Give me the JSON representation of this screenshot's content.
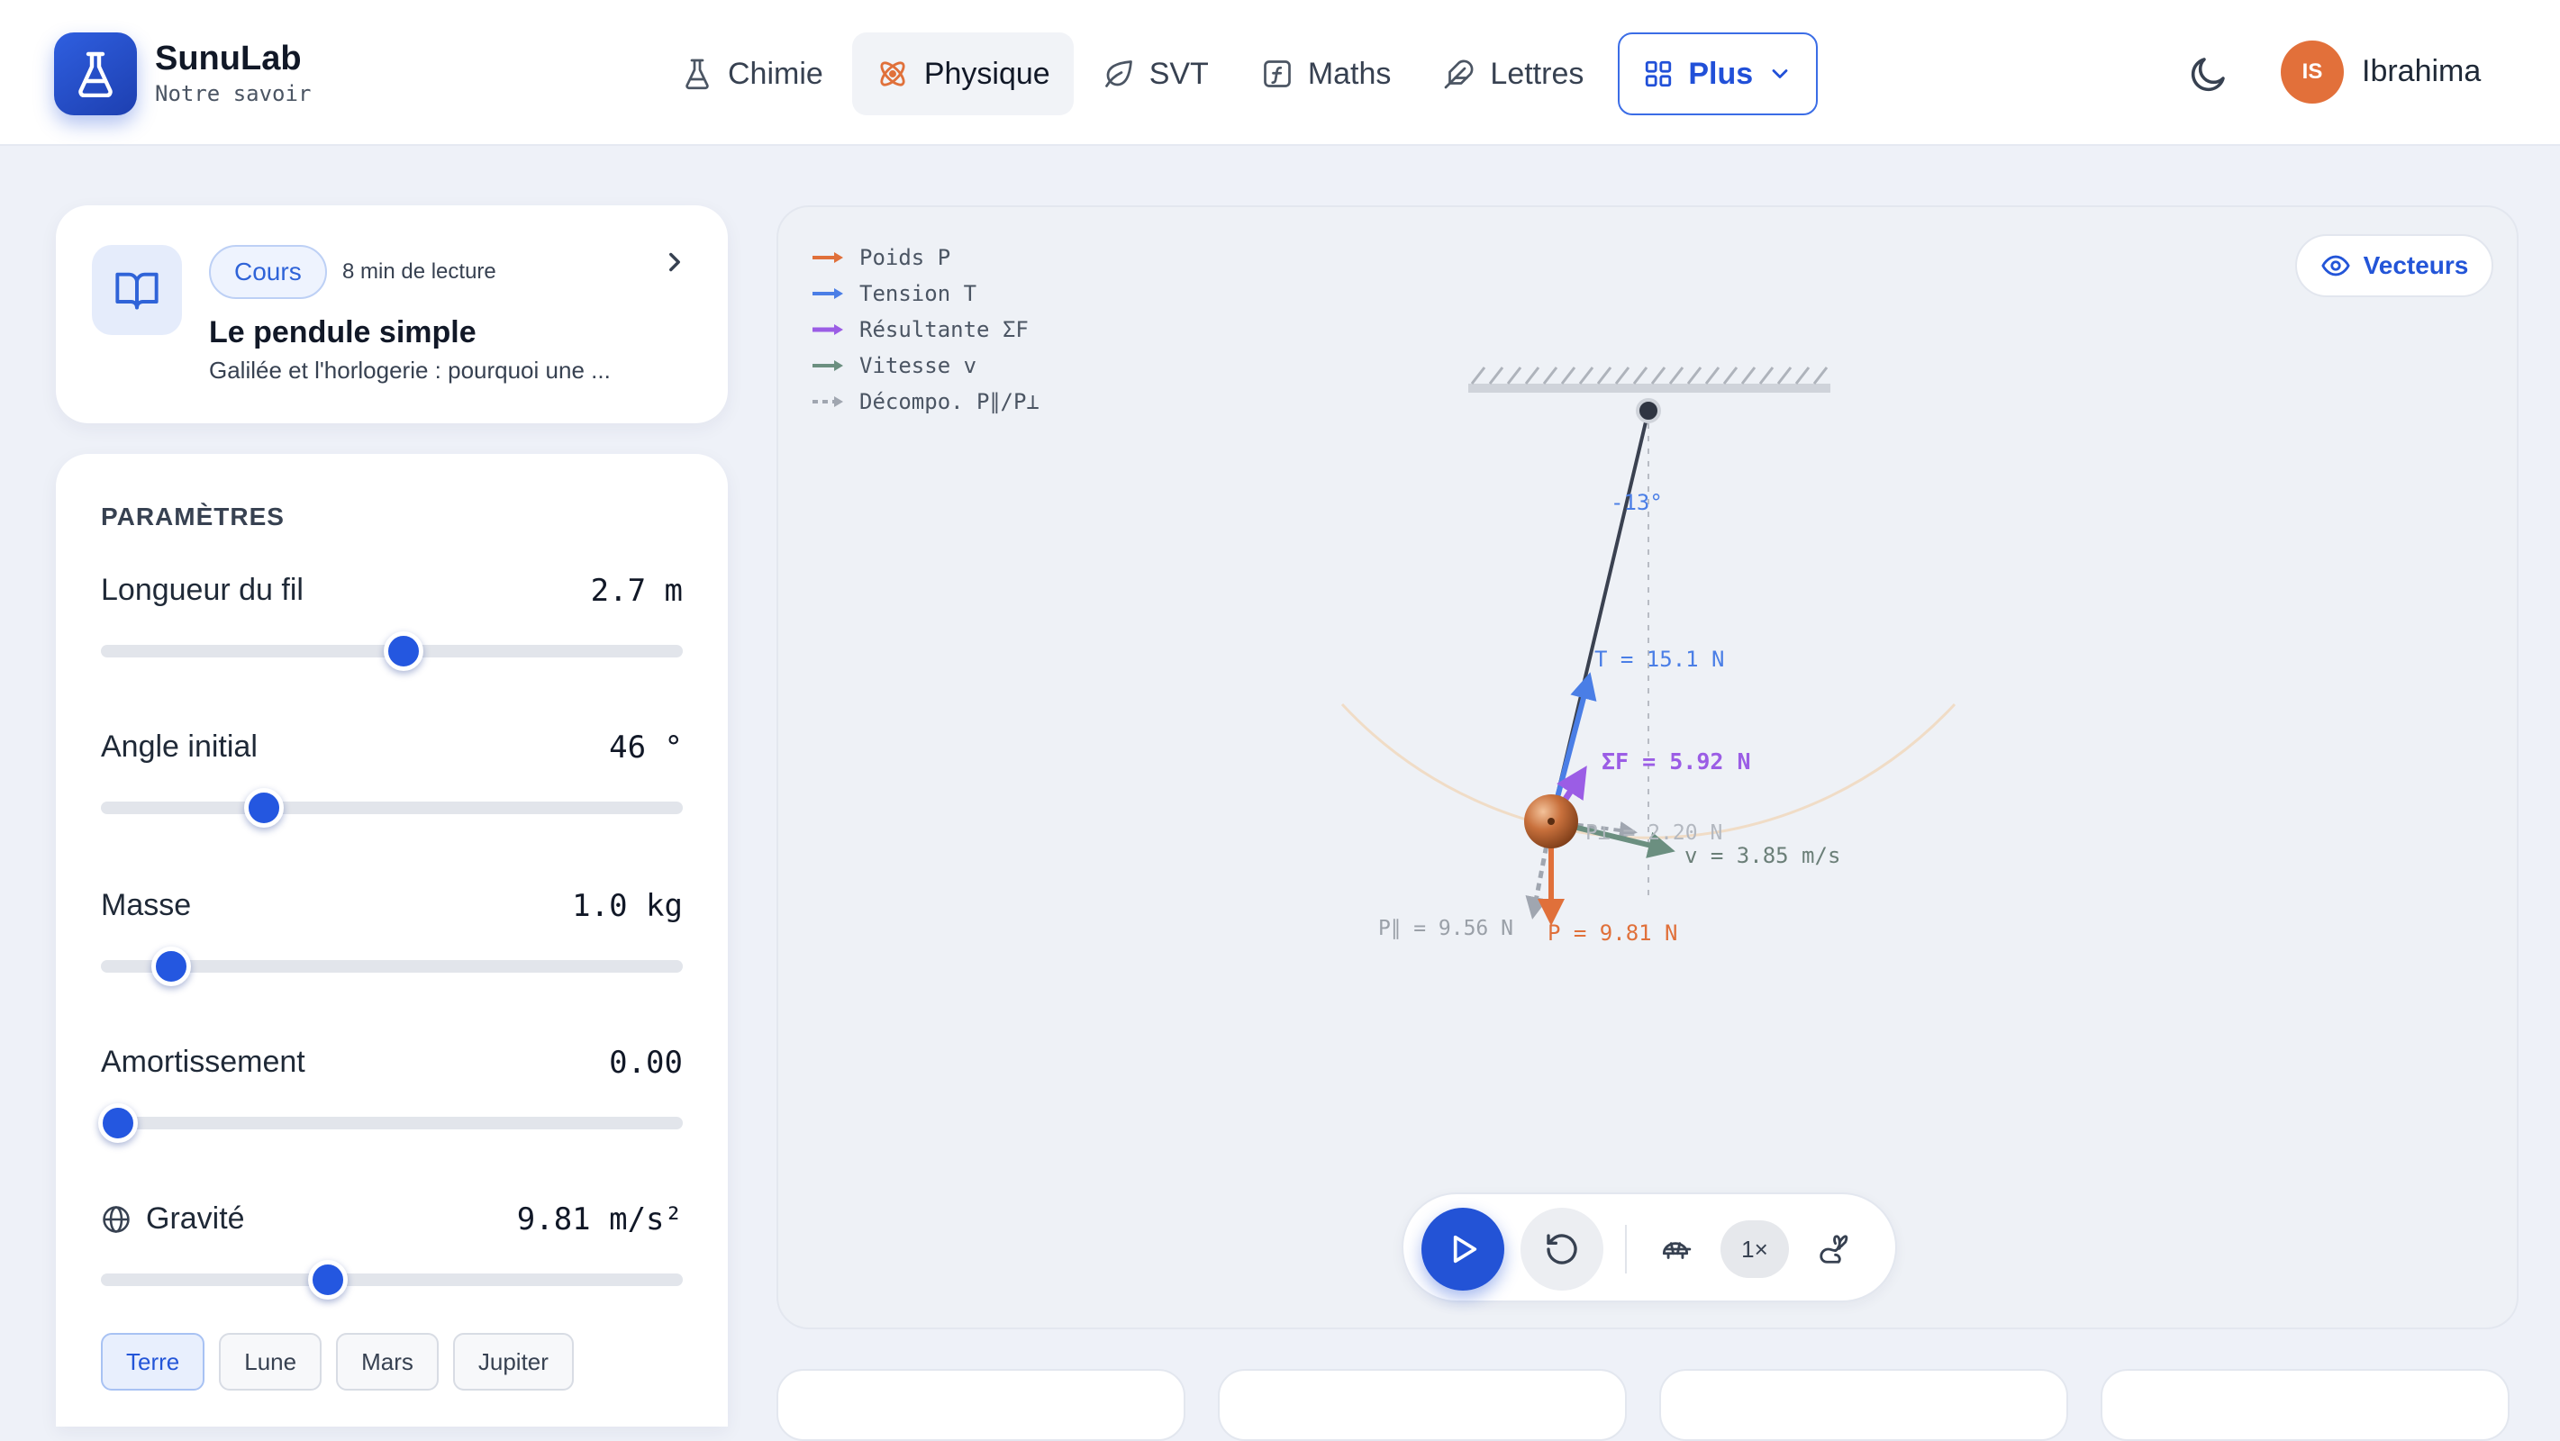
{
  "brand": {
    "name": "SunuLab",
    "tagline": "Notre savoir"
  },
  "nav": {
    "items": [
      {
        "label": "Chimie",
        "icon": "flask-icon"
      },
      {
        "label": "Physique",
        "icon": "atom-icon",
        "active": true
      },
      {
        "label": "SVT",
        "icon": "leaf-icon"
      },
      {
        "label": "Maths",
        "icon": "function-icon"
      },
      {
        "label": "Lettres",
        "icon": "feather-icon"
      }
    ],
    "more_label": "Plus"
  },
  "user": {
    "initials": "IS",
    "name": "Ibrahima",
    "avatar_color": "#e2703a"
  },
  "lesson": {
    "badge": "Cours",
    "read_time": "8 min de lecture",
    "title": "Le pendule simple",
    "subtitle": "Galilée et l'horlogerie : pourquoi une ..."
  },
  "params": {
    "title": "PARAMÈTRES",
    "length": {
      "label": "Longueur du fil",
      "value": "2.7 m",
      "fraction": 0.52
    },
    "angle": {
      "label": "Angle initial",
      "value": "46 °",
      "fraction": 0.28
    },
    "mass": {
      "label": "Masse",
      "value": "1.0 kg",
      "fraction": 0.12
    },
    "damping": {
      "label": "Amortissement",
      "value": "0.00",
      "fraction": 0.03
    },
    "gravity": {
      "label": "Gravité",
      "value": "9.81 m/s²",
      "fraction": 0.39
    },
    "presets": [
      "Terre",
      "Lune",
      "Mars",
      "Jupiter"
    ],
    "active_preset": "Terre"
  },
  "sim": {
    "legend": [
      {
        "label": "Poids P",
        "color": "#e0703a",
        "dashed": false
      },
      {
        "label": "Tension T",
        "color": "#4a7ee6",
        "dashed": false
      },
      {
        "label": "Résultante ΣF",
        "color": "#9b5de5",
        "dashed": false
      },
      {
        "label": "Vitesse v",
        "color": "#6b8f80",
        "dashed": false
      },
      {
        "label": "Décompo. P∥/P⊥",
        "color": "#a0a6b0",
        "dashed": true
      }
    ],
    "vectors_button": "Vecteurs",
    "angle_label": "-13°",
    "tension_label": "T = 15.1 N",
    "resultant_label": "ΣF = 5.92 N",
    "perp_label": "P⊥ = 2.20 N",
    "velocity_label": "v = 3.85 m/s",
    "parallel_label": "P∥ = 9.56 N",
    "weight_label": "P = 9.81 N",
    "speed_label": "1×",
    "colors": {
      "weight": "#e0703a",
      "tension": "#4a7ee6",
      "resultant": "#9b5de5",
      "velocity": "#6b8f80",
      "decomp": "#a0a6b0",
      "string": "#3a4150",
      "accent": "#2353d6"
    }
  }
}
